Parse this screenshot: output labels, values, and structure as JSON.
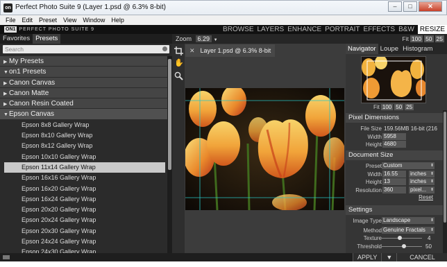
{
  "window": {
    "title": "Perfect Photo Suite 9 (Layer 1.psd @ 6.3% 8-bit)",
    "buttons": {
      "minimize": "–",
      "maximize": "□",
      "close": "✕"
    }
  },
  "menu": [
    "File",
    "Edit",
    "Preset",
    "View",
    "Window",
    "Help"
  ],
  "brand": {
    "mark": "ON1",
    "name": "PERFECT PHOTO SUITE 9"
  },
  "modules": [
    "BROWSE",
    "LAYERS",
    "ENHANCE",
    "PORTRAIT",
    "EFFECTS",
    "B&W",
    "RESIZE"
  ],
  "left": {
    "tabs": [
      "Favorites",
      "Presets"
    ],
    "search_placeholder": "Search",
    "tree": [
      {
        "kind": "group",
        "label": "My Presets",
        "arrow": "▶"
      },
      {
        "kind": "group",
        "label": "on1 Presets",
        "arrow": "▼"
      },
      {
        "kind": "group",
        "label": "Canon Canvas",
        "arrow": "▶"
      },
      {
        "kind": "group",
        "label": "Canon Matte",
        "arrow": "▶"
      },
      {
        "kind": "group",
        "label": "Canon Resin Coated",
        "arrow": "▶"
      },
      {
        "kind": "group",
        "label": "Epson Canvas",
        "arrow": "▼"
      },
      {
        "kind": "item",
        "label": "Epson 8x8 Gallery Wrap"
      },
      {
        "kind": "item",
        "label": "Epson 8x10 Gallery Wrap"
      },
      {
        "kind": "item",
        "label": "Epson 8x12 Gallery Wrap"
      },
      {
        "kind": "item",
        "label": "Epson 10x10 Gallery Wrap"
      },
      {
        "kind": "item",
        "label": "Epson 11x14 Gallery Wrap",
        "selected": true
      },
      {
        "kind": "item",
        "label": "Epson 16x16 Gallery Wrap"
      },
      {
        "kind": "item",
        "label": "Epson 16x20 Gallery Wrap"
      },
      {
        "kind": "item",
        "label": "Epson 16x24 Gallery Wrap"
      },
      {
        "kind": "item",
        "label": "Epson 20x20 Gallery Wrap"
      },
      {
        "kind": "item",
        "label": "Epson 20x24 Gallery Wrap"
      },
      {
        "kind": "item",
        "label": "Epson 20x30 Gallery Wrap"
      },
      {
        "kind": "item",
        "label": "Epson 24x24 Gallery Wrap"
      },
      {
        "kind": "item",
        "label": "Epson 24x30 Gallery Wrap"
      }
    ]
  },
  "center": {
    "zoom_label": "Zoom",
    "zoom_value": "6.29",
    "doc_tab": "Layer 1.psd @ 6.3% 8-bit",
    "tools": [
      "crop-icon",
      "hand-icon",
      "zoom-icon"
    ]
  },
  "right": {
    "fit_buttons": [
      "Fit",
      "100",
      "50",
      "25"
    ],
    "tabs": [
      "Navigator",
      "Loupe",
      "Histogram"
    ],
    "pixel_dimensions": {
      "title": "Pixel Dimensions",
      "file_size_label": "File Size",
      "file_size": "159.56MB 16-bit (216",
      "width_label": "Width",
      "width": "5958",
      "height_label": "Height",
      "height": "4680"
    },
    "document_size": {
      "title": "Document Size",
      "preset_label": "Preset",
      "preset": "Custom",
      "width_label": "Width",
      "width": "16.55",
      "width_unit": "inches",
      "height_label": "Height",
      "height": "13",
      "height_unit": "inches",
      "resolution_label": "Resolution",
      "resolution": "360",
      "resolution_unit": "pixel...",
      "reset": "Reset"
    },
    "settings": {
      "title": "Settings",
      "image_type_label": "Image Type",
      "image_type": "Landscape",
      "method_label": "Method",
      "method": "Genuine Fractals",
      "texture_label": "Texture",
      "texture": "4",
      "texture_level": 0.4,
      "threshold_label": "Threshold",
      "threshold": "50",
      "threshold_level": 0.5
    }
  },
  "bottom": {
    "apply": "APPLY",
    "menu": "▼",
    "cancel": "CANCEL"
  },
  "colors": {
    "panel": "#2b2b2b",
    "guides": "#29c4c4",
    "selected_row": "#c9c9c9"
  }
}
